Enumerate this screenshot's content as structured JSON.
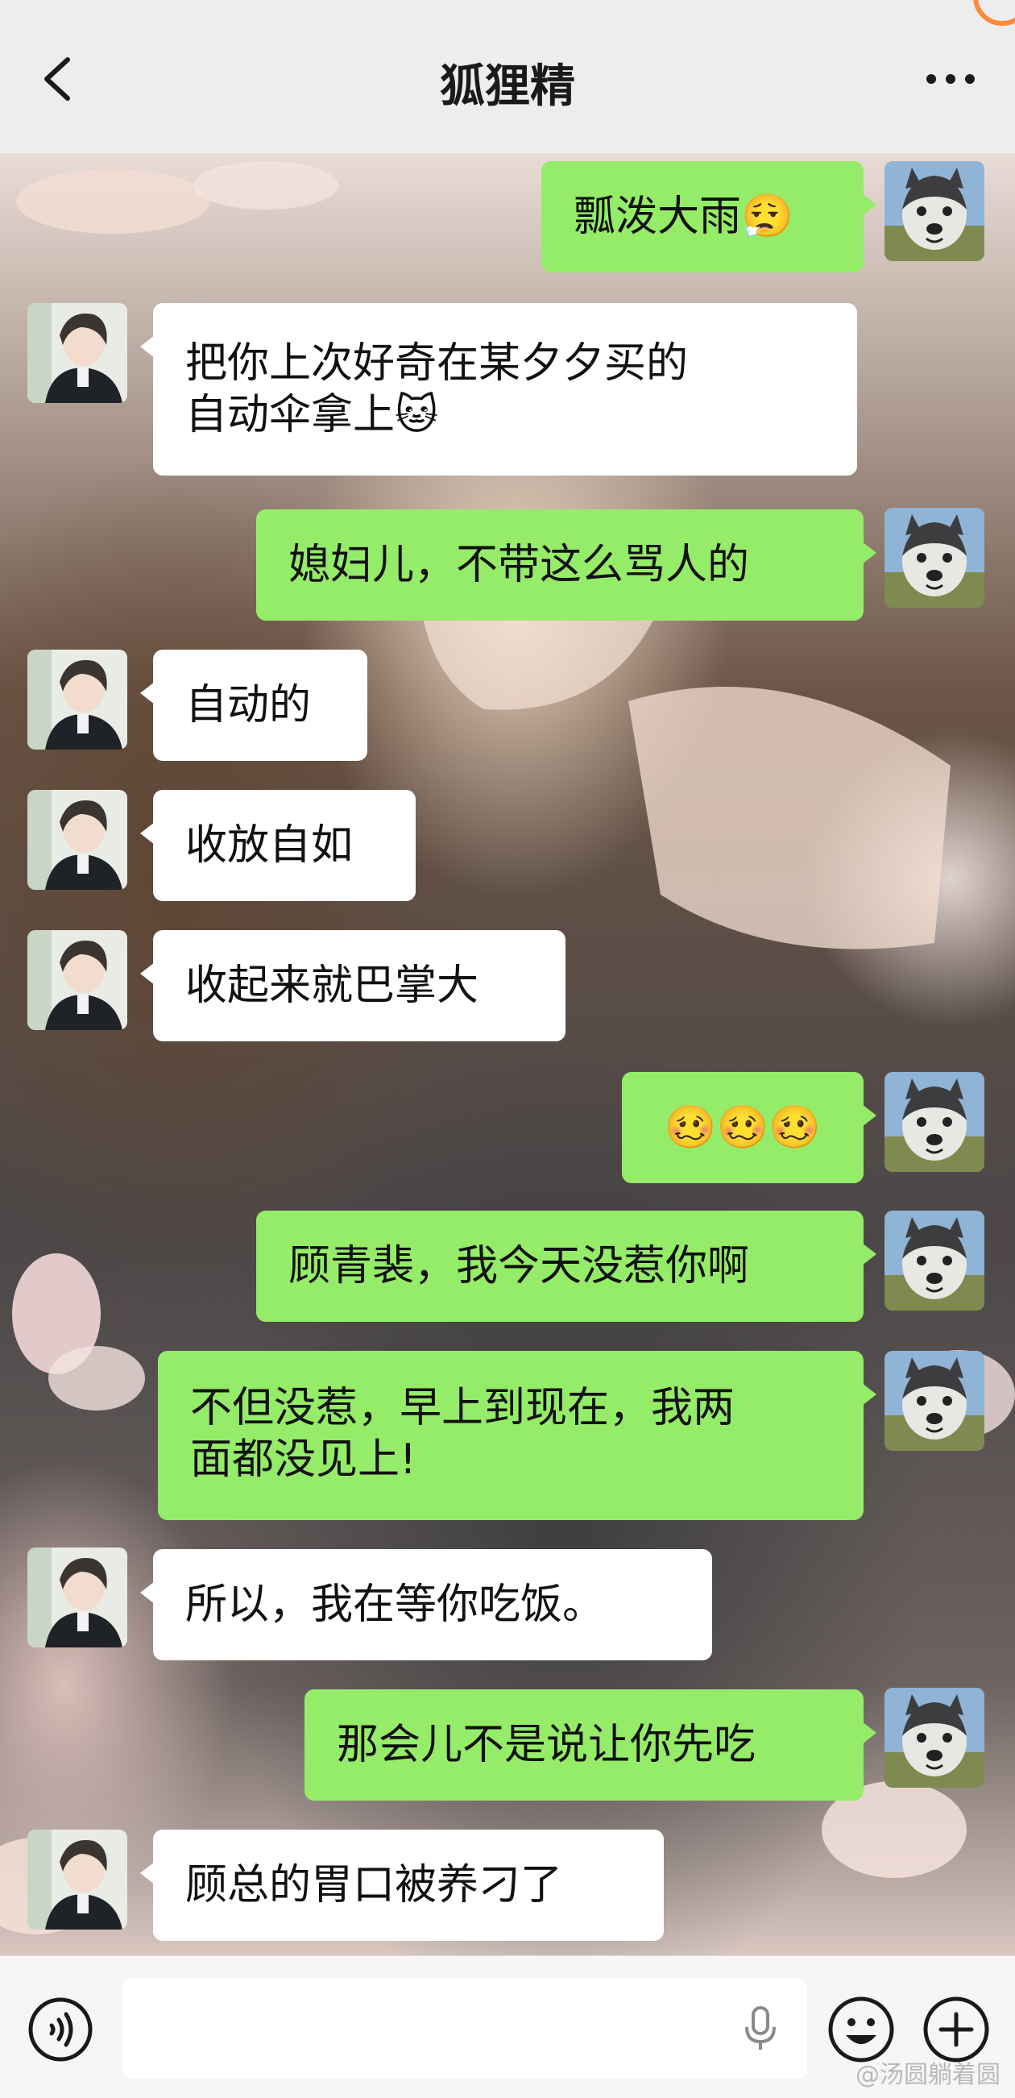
{
  "header": {
    "title": "狐狸精"
  },
  "messages": [
    {
      "side": "right",
      "text": "瓢泼大雨😮‍💨"
    },
    {
      "side": "left",
      "line1": "把你上次好奇在某夕夕买的",
      "line2": "自动伞拿上🐱"
    },
    {
      "side": "right",
      "text": "媳妇儿，不带这么骂人的"
    },
    {
      "side": "left",
      "text": "自动的"
    },
    {
      "side": "left",
      "text": "收放自如"
    },
    {
      "side": "left",
      "text": "收起来就巴掌大"
    },
    {
      "side": "right",
      "text": "🥴🥴🥴"
    },
    {
      "side": "right",
      "text": "顾青裴，我今天没惹你啊"
    },
    {
      "side": "right",
      "line1": "不但没惹，早上到现在，我两",
      "line2": "面都没见上!"
    },
    {
      "side": "left",
      "text": "所以，我在等你吃饭。"
    },
    {
      "side": "right",
      "text": "那会儿不是说让你先吃"
    },
    {
      "side": "left",
      "text": "顾总的胃口被养刁了"
    }
  ],
  "footer": {
    "input_placeholder": ""
  },
  "watermark": "@汤圆躺着圆",
  "colors": {
    "accent_bubble": "#95ec69",
    "left_bubble": "#ffffff",
    "header_bg": "#ededed"
  },
  "icons": [
    "back-arrow-icon",
    "more-icon",
    "voice-icon",
    "mic-icon",
    "emoji-icon",
    "plus-icon"
  ]
}
